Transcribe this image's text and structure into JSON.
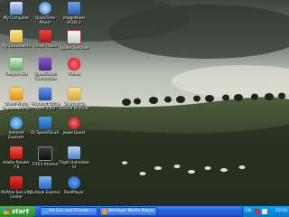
{
  "desktop": {
    "icons": [
      {
        "label": "My Computer",
        "icon": "computer-icon"
      },
      {
        "label": "QuickTime Player",
        "icon": "quicktime-icon"
      },
      {
        "label": "ImageMixer VCD2 2",
        "icon": "imagemixer-icon"
      },
      {
        "label": "My Documents",
        "icon": "documents-icon"
      },
      {
        "label": "Chess Titans",
        "icon": "chess-icon"
      },
      {
        "label": "Spider Solitaire",
        "icon": "solitaire-icon"
      },
      {
        "label": "Recycle Bin",
        "icon": "recycle-bin-icon"
      },
      {
        "label": "SpeedTouch Connection",
        "icon": "speedtouch-icon"
      },
      {
        "label": "iTunes",
        "icon": "itunes-icon"
      },
      {
        "label": "Ulead Photo Express 3.0 SE",
        "icon": "ulead-icon"
      },
      {
        "label": "Microsoft Office Word 2003",
        "icon": "word-icon"
      },
      {
        "label": "Shortcut to Shared Pictures",
        "icon": "shared-pictures-icon"
      },
      {
        "label": "Internet Explorer",
        "icon": "internet-explorer-icon"
      },
      {
        "label": "Dr SpeedTouch",
        "icon": "dr-speedtouch-icon"
      },
      {
        "label": "Jewel Quest",
        "icon": "jewel-quest-icon"
      },
      {
        "label": "Adobe Reader 7.0",
        "icon": "adobe-reader-icon"
      },
      {
        "label": "FIFE3 Xtreme",
        "icon": "fife-icon"
      },
      {
        "label": "Flight Unlimited III",
        "icon": "flight-icon"
      },
      {
        "label": "McAfee Security Center",
        "icon": "mcafee-icon"
      },
      {
        "label": "Outlook Express",
        "icon": "outlook-express-icon"
      },
      {
        "label": "RealPlayer",
        "icon": "realplayer-icon"
      }
    ]
  },
  "taskbar": {
    "start_label": "start",
    "buttons": [
      {
        "label": "Fat Eric and Friends - ...",
        "icon": "browser-icon"
      },
      {
        "label": "Windows Media Player",
        "icon": "media-player-icon"
      }
    ],
    "tray": {
      "language": "EN",
      "clock": "23:54"
    }
  },
  "colors": {
    "taskbar": "#245edc",
    "start_button": "#3c9a3c",
    "tray": "#0d8ae0"
  }
}
